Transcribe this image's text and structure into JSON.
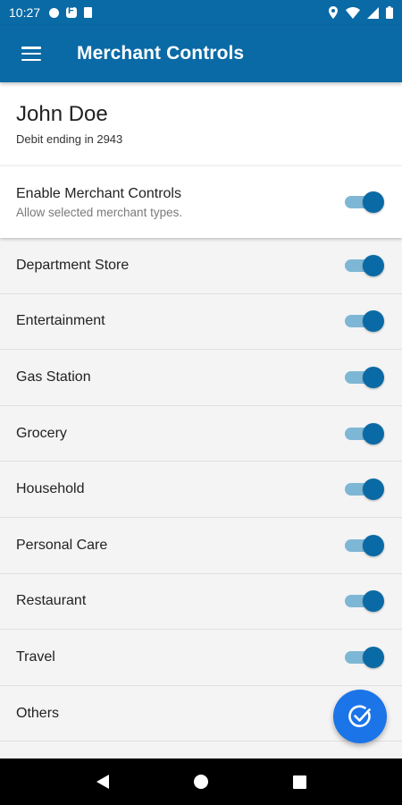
{
  "status_bar": {
    "time": "10:27",
    "left_icons": [
      "notification-dot-icon",
      "app-f-icon",
      "sim-card-icon"
    ],
    "right_icons": [
      "location-icon",
      "wifi-icon",
      "signal-icon",
      "battery-icon"
    ]
  },
  "app_bar": {
    "title": "Merchant Controls",
    "menu_icon": "hamburger-menu-icon"
  },
  "account": {
    "name": "John Doe",
    "subtitle": "Debit ending in 2943"
  },
  "master_toggle": {
    "title": "Enable Merchant Controls",
    "subtitle": "Allow selected merchant types.",
    "enabled": true
  },
  "merchant_types": [
    {
      "label": "Department Store",
      "enabled": true
    },
    {
      "label": "Entertainment",
      "enabled": true
    },
    {
      "label": "Gas Station",
      "enabled": true
    },
    {
      "label": "Grocery",
      "enabled": true
    },
    {
      "label": "Household",
      "enabled": true
    },
    {
      "label": "Personal Care",
      "enabled": true
    },
    {
      "label": "Restaurant",
      "enabled": true
    },
    {
      "label": "Travel",
      "enabled": true
    },
    {
      "label": "Others",
      "enabled": true
    }
  ],
  "fab": {
    "icon": "check-circle-icon"
  },
  "colors": {
    "primary": "#0a6aa5",
    "fab": "#1b74e8",
    "toggle_track": "#7eb7d6"
  }
}
